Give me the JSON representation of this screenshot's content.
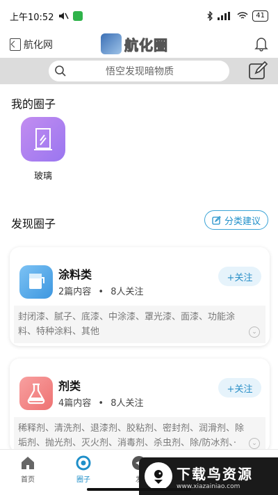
{
  "status_bar": {
    "time": "上午10:52",
    "battery": "41"
  },
  "header": {
    "back_label": "航化网",
    "logo_text": "航化圈"
  },
  "search": {
    "placeholder": "悟空发现暗物质"
  },
  "my_circles": {
    "title": "我的圈子",
    "items": [
      {
        "label": "玻璃",
        "icon": "glass-icon",
        "color": "#a77cf0"
      }
    ]
  },
  "discover": {
    "title": "发现圈子",
    "suggest_label": "分类建议",
    "cards": [
      {
        "name": "涂料类",
        "posts": "2篇内容",
        "sep": "•",
        "followers": "8人关注",
        "follow_label": "+关注",
        "description": "封闭漆、腻子、底漆、中涂漆、罩光漆、面漆、功能涂料、特种涂料、其他",
        "icon": "paint-bucket-icon",
        "color": "#4aa3e8"
      },
      {
        "name": "剂类",
        "posts": "4篇内容",
        "sep": "•",
        "followers": "8人关注",
        "follow_label": "+关注",
        "description": "稀释剂、清洗剂、退漆剂、胶粘剂、密封剂、润滑剂、除垢剂、抛光剂、灭火剂、消毒剂、杀虫剂、除/防冰剂、·",
        "icon": "flask-icon",
        "color": "#f07b7b"
      }
    ]
  },
  "bottom_nav": [
    {
      "label": "首页",
      "icon": "home-icon"
    },
    {
      "label": "圈子",
      "icon": "circle-icon"
    },
    {
      "label": "发",
      "icon": "send-icon"
    },
    {
      "label": "",
      "icon": "message-icon"
    },
    {
      "label": "",
      "icon": "more-icon"
    }
  ],
  "watermark": {
    "title": "下载鸟资源",
    "url": "www.xiazainiao.com"
  }
}
